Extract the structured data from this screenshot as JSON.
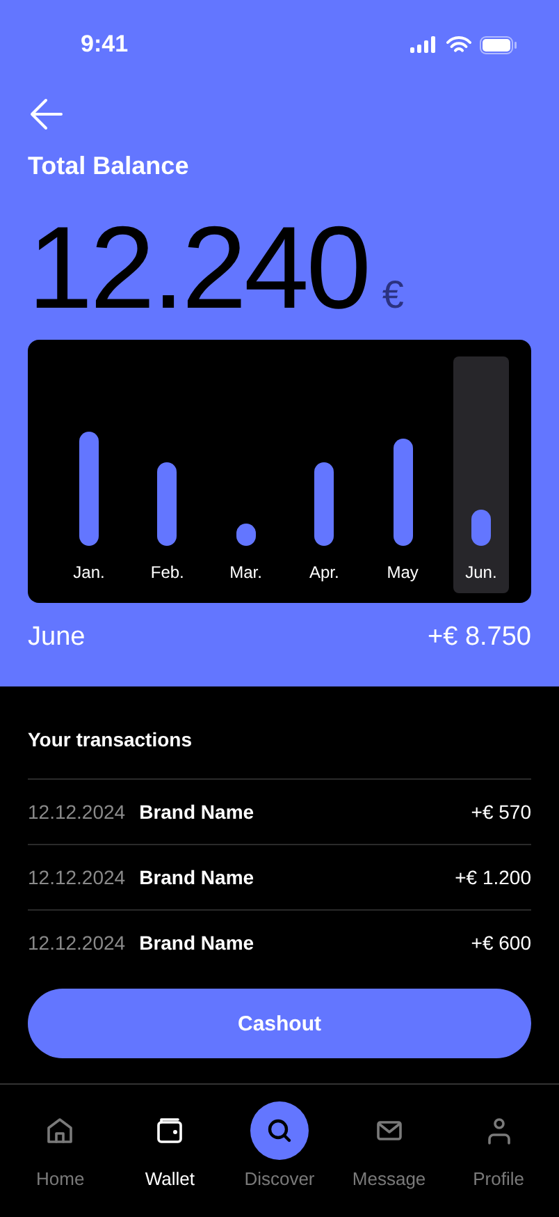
{
  "status_bar": {
    "time": "9:41"
  },
  "header": {
    "title": "Total Balance",
    "amount": "12.240",
    "currency": "€"
  },
  "months": [
    {
      "label": "Jan.",
      "selected": false
    },
    {
      "label": "Feb.",
      "selected": false
    },
    {
      "label": "Mar.",
      "selected": false
    },
    {
      "label": "Apr.",
      "selected": false
    },
    {
      "label": "May",
      "selected": false
    },
    {
      "label": "Jun.",
      "selected": true
    }
  ],
  "summary": {
    "month": "June",
    "amount": "+€ 8.750"
  },
  "transactions": {
    "title": "Your transactions",
    "rows": [
      {
        "date": "12.12.2024",
        "name": "Brand Name",
        "amount": "+€ 570"
      },
      {
        "date": "12.12.2024",
        "name": "Brand Name",
        "amount": "+€ 1.200"
      },
      {
        "date": "12.12.2024",
        "name": "Brand Name",
        "amount": "+€ 600"
      }
    ]
  },
  "cashout_button": "Cashout",
  "nav": [
    {
      "label": "Home",
      "kind": "plain",
      "selected": false
    },
    {
      "label": "Wallet",
      "kind": "plain",
      "selected": true
    },
    {
      "label": "Discover",
      "kind": "featured",
      "selected": false
    },
    {
      "label": "Message",
      "kind": "plain",
      "selected": false
    },
    {
      "label": "Profile",
      "kind": "plain",
      "selected": false
    }
  ]
}
